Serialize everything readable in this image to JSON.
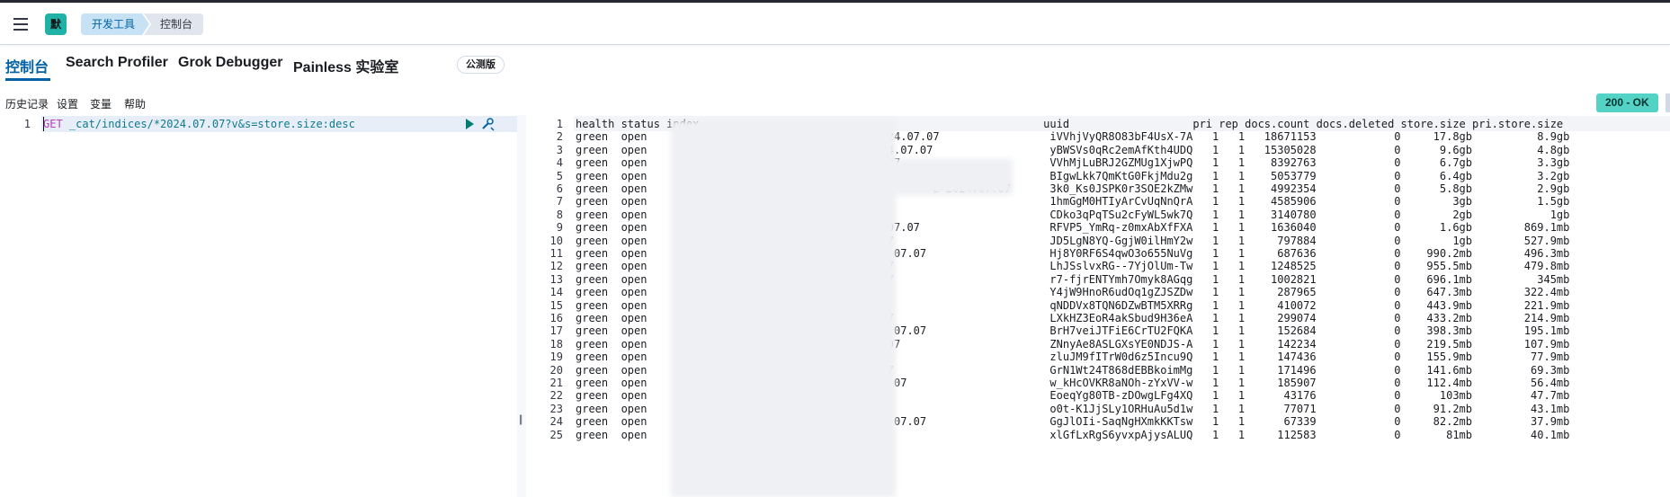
{
  "header": {
    "logo_text": "默",
    "breadcrumbs": [
      "开发工具",
      "控制台"
    ]
  },
  "tabs": [
    {
      "label": "控制台",
      "active": true
    },
    {
      "label": "Search Profiler",
      "active": false
    },
    {
      "label": "Grok Debugger",
      "active": false
    },
    {
      "label": "Painless 实验室",
      "active": false
    }
  ],
  "beta_badge": "公测版",
  "toolbar": {
    "history": "历史记录",
    "settings": "设置",
    "variables": "变量",
    "help": "帮助",
    "status": "200 - OK"
  },
  "request": {
    "line_number": "1",
    "method": "GET",
    "path": " _cat/indices/*2024.07.07?v&s=store.size:desc"
  },
  "response": {
    "lines": [
      "health status index                                                     uuid                   pri rep docs.count docs.deleted store.size pri.store.size",
      "green  open                                 z-2024.07.07                 iVVhjVyQR8O83bF4UsX-7A   1   1   18671153            0     17.8gb          8.9gb",
      "green  open                                z-2024.07.07                  yBWSVs0qRc2emAfKth4UDQ   1   1   15305028            0      9.6gb          4.8gb",
      "green  open                             2024.07.07                       VVhMjLuBRJ2GZMUg1XjwPQ   1   1    8392763            0      6.7gb          3.3gb",
      "green  open                                         z-2024.07.07         BIgwLkk7QmKtG0FkjMdu2g   1   1    5053779            0      6.4gb          3.2gb",
      "green  open                                            z-2024.07.07      3k0_Ks0JSPK0r3SOE2kZMw   1   1    4992354            0      5.8gb          2.9gb",
      "green  open                        2024.07.07                            1hmGgM0HTIyArCvUqNnQrA   1   1    4585906            0        3gb          1.5gb",
      "green  open                        -2024.07.07                           CDko3qPqTSu2cFyWL5wk7Q   1   1    3140780            0        2gb            1gb",
      "green  open                              z-2024.07.07                    RFVP5_YmRq-z0mxAbXfFXA   1   1    1636040            0      1.6gb        869.1mb",
      "green  open                          z-2024.07.07                        JD5LgN8YQ-GgjW0ilHmY2w   1   1     797884            0        1gb        527.9mb",
      "green  open                               z-2024.07.07                   Hj8Y0RF6S4qwO3o655NuVg   1   1     687636            0    990.2mb        496.3mb",
      "green  open                            2024.07.07                        LhJSslvxRG--7YjOlUm-Tw   1   1    1248525            0    955.5mb        479.8mb",
      "green  open                            2024.07.07                        r7-fjrENTYmh7Omyk8AGqg   1   1    1002821            0    696.1mb          345mb",
      "green  open                       2024.07.07                             Y4jW9HnoR6udOq1gZJSZDw   1   1     287965            0    647.3mb        322.4mb",
      "green  open                       2024.07.07                             qNDDVx8TQN6DZwBTM5XRRg   1   1     410072            0    443.9mb        221.9mb",
      "green  open                           -2024.07.07                        LXkHZ3EoR4akSbud9H36eA   1   1     299074            0    433.2mb        214.9mb",
      "green  open                              ge-2024.07.07                   BrH7veiJTFiE6CrTU2FQKA   1   1     152684            0    398.3mb        195.1mb",
      "green  open                            -2024.07.07                       ZNnyAe8ASLGXsYE0NDJS-A   1   1     142234            0    219.5mb        107.9mb",
      "green  open                          2024.07.07                          zluJM9fITrW0d6z5Incu9Q   1   1     147436            0    155.9mb         77.9mb",
      "green  open                         iz-2024.07.07                        GrN1Wt24T868dEBBkoimMg   1   1     171496            0    141.6mb         69.3mb",
      "green  open                           iz-2024.07.07                      w_kHcOVKR8aNOh-zYxVV-w   1   1     185907            0    112.4mb         56.4mb",
      "green  open                      e-2024.07.07                            EoeqYg80TB-zDOwgLFg4XQ   1   1      43176            0      103mb         47.7mb",
      "green  open                        -2024.07.07                           o0t-K1JjSLy1ORHuAu5d1w   1   1      77071            0     91.2mb         43.1mb",
      "green  open                               z-2024.07.07                   GgJlOIi-SaqNgHXmkKKTsw   1   1      67339            0     82.2mb         37.9mb",
      "green  open                       iz-2024.07.07                          xlGfLxRgS6yvxpAjysALUQ   1   1     112583            0       81mb         40.1mb"
    ]
  },
  "divider_grip": "||",
  "colors": {
    "accent": "#0061a6",
    "status_ok": "#54d2c6",
    "logo": "#20b2a6"
  }
}
